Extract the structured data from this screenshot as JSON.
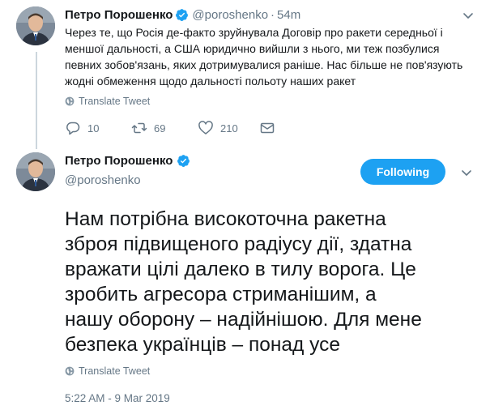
{
  "tweet1": {
    "name": "Петро Порошенко",
    "handle": "@poroshenko",
    "separator": "·",
    "time": "54m",
    "text_lines": [
      "Через те, що Росія де-факто зруйнувала Договір про ракети середньої і",
      "меншої дальності, а США юридично вийшли з нього, ми теж позбулися",
      "певних зобов'язань, яких дотримувалися раніше. Нас більше не пов'язують",
      "жодні обмеження щодо дальності польоту наших ракет"
    ],
    "translate_label": "Translate Tweet",
    "actions": {
      "replies": "10",
      "retweets": "69",
      "likes": "210"
    },
    "icons": {
      "avatar": "avatar-photo",
      "verified": "verified-badge-icon",
      "caret": "chevron-down-icon",
      "globe": "globe-icon",
      "reply": "reply-icon",
      "retweet": "retweet-icon",
      "like": "heart-icon",
      "dm": "direct-message-icon"
    }
  },
  "tweet2": {
    "name": "Петро Порошенко",
    "handle": "@poroshenko",
    "follow_label": "Following",
    "text_lines": [
      "Нам потрібна високоточна ракетна",
      "зброя підвищеного радіусу дії, здатна",
      "вражати цілі далеко в тилу ворога. Це",
      "зробить агресора стриманішим, а",
      "нашу оборону – надійнішою. Для мене",
      "безпека українців – понад усе"
    ],
    "translate_label": "Translate Tweet",
    "timestamp": "5:22 AM - 9 Mar 2019"
  },
  "colors": {
    "accent": "#1da1f2",
    "text": "#14171a",
    "muted": "#657786",
    "thread_line": "#ccd6dd"
  }
}
